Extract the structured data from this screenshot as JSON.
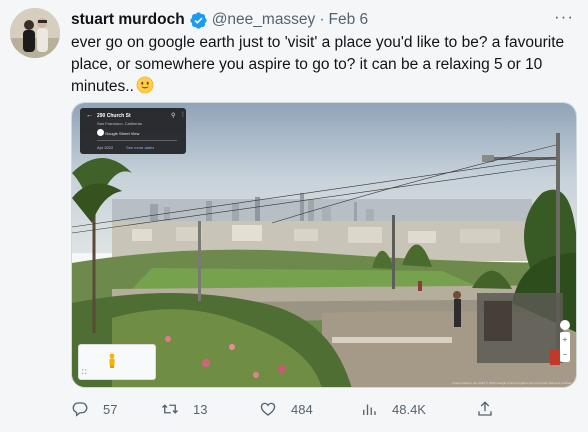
{
  "author": {
    "display_name": "stuart murdoch",
    "handle": "@nee_massey",
    "separator": "·",
    "date": "Feb 6",
    "verified": true
  },
  "tweet": {
    "text": "ever go on google earth just to 'visit' a place you'd like to be? a favourite place, or somewhere you aspire to go to? it can be a relaxing 5 or 10 minutes..",
    "emoji": "smiling-face-emoji"
  },
  "media": {
    "street_view_card": {
      "address": "290 Church St",
      "city": "San Francisco, California",
      "source": "Google Street View",
      "capture_date": "Apr 2022",
      "more_dates_link": "See more dates"
    },
    "attribution": "Image capture: Apr 2022  © 2023 Google   United Kingdom   Terms   Privacy   Report a problem"
  },
  "actions": {
    "reply_count": "57",
    "retweet_count": "13",
    "like_count": "484",
    "views_count": "48.4K"
  },
  "colors": {
    "accent": "#1d9bf0",
    "secondary_text": "#536471",
    "background": "#f5f6f8"
  }
}
